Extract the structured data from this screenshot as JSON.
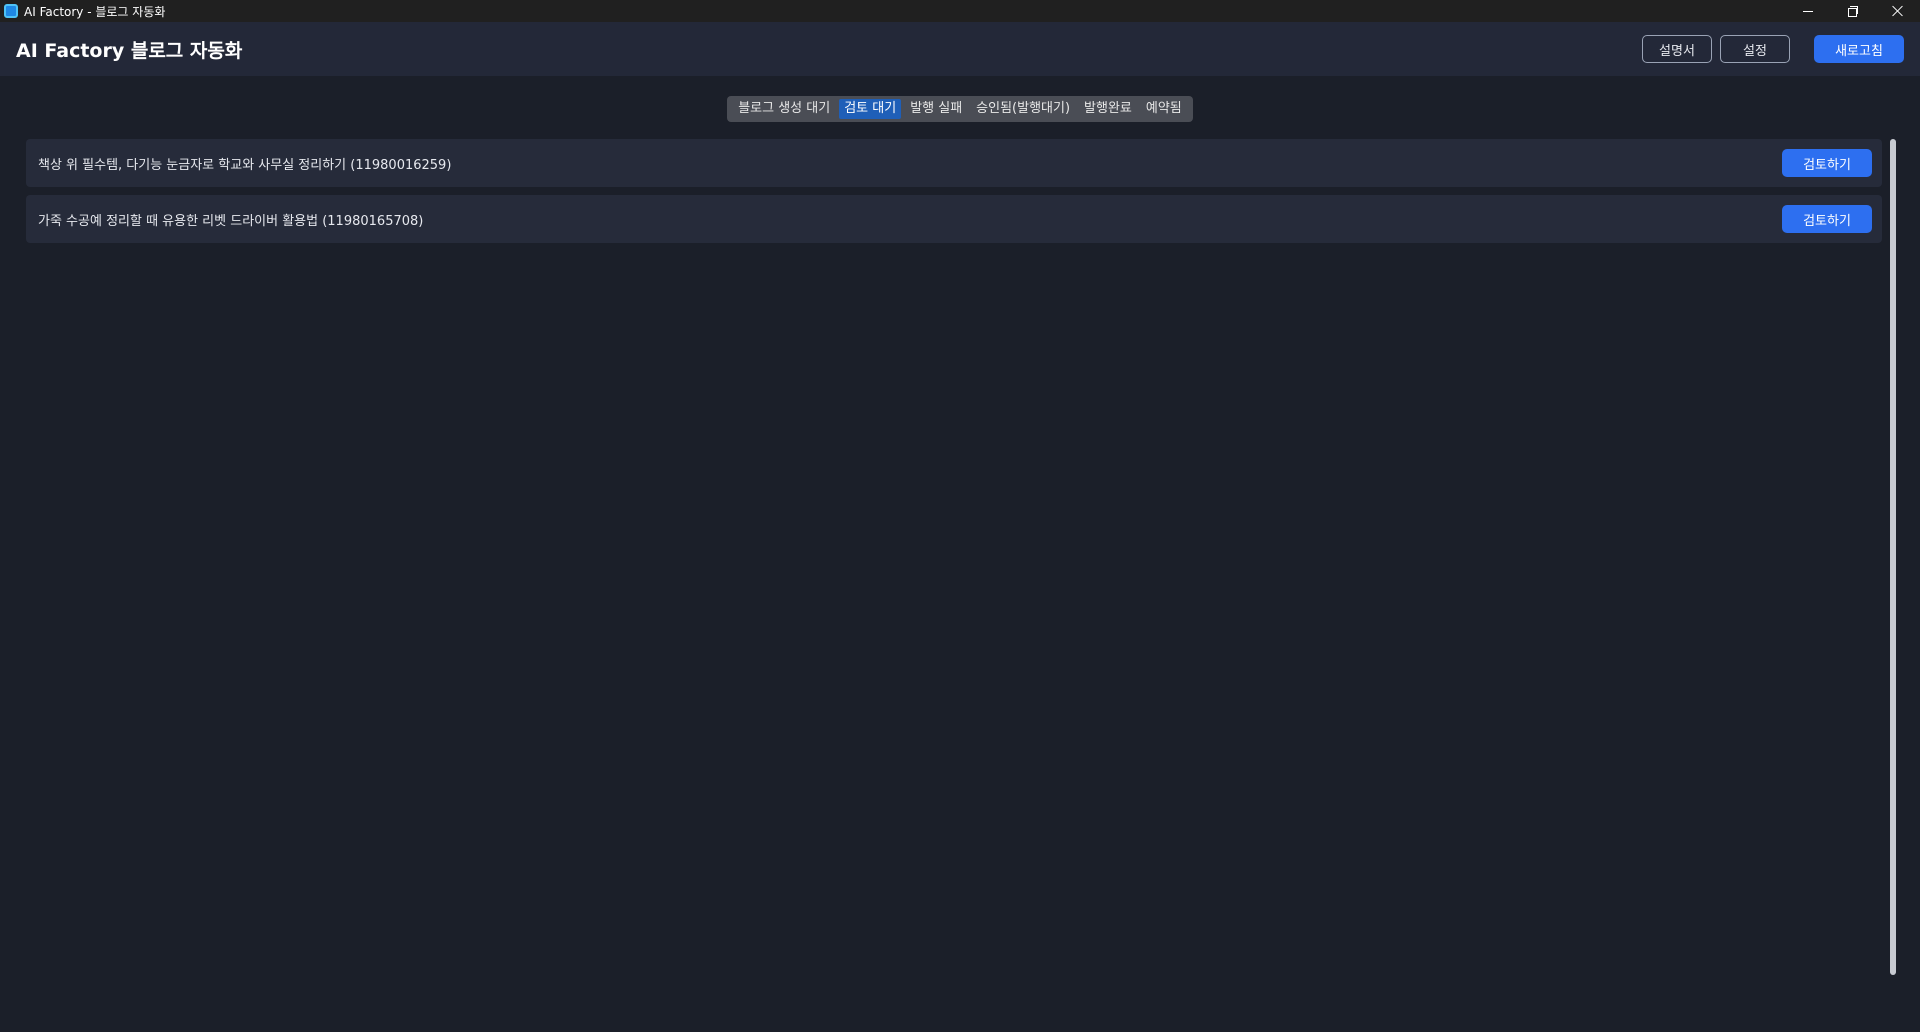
{
  "window": {
    "title": "AI Factory - 블로그 자동화"
  },
  "header": {
    "title": "AI Factory 블로그 자동화",
    "help_label": "설명서",
    "settings_label": "설정",
    "refresh_label": "새로고침"
  },
  "tabs": [
    {
      "label": "블로그 생성 대기",
      "active": false
    },
    {
      "label": "검토 대기",
      "active": true
    },
    {
      "label": "발행 실패",
      "active": false
    },
    {
      "label": "승인됨(발행대기)",
      "active": false
    },
    {
      "label": "발행완료",
      "active": false
    },
    {
      "label": "예약됨",
      "active": false
    }
  ],
  "items": [
    {
      "title": "책상 위 필수템, 다기능 눈금자로 학교와 사무실 정리하기 (11980016259)",
      "action_label": "검토하기"
    },
    {
      "title": "가죽 수공예 정리할 때 유용한 리벳 드라이버 활용법 (11980165708)",
      "action_label": "검토하기"
    }
  ],
  "colors": {
    "background": "#1b1f29",
    "header": "#232838",
    "accent": "#2d6ff0",
    "active_tab": "#1f5fb8"
  }
}
